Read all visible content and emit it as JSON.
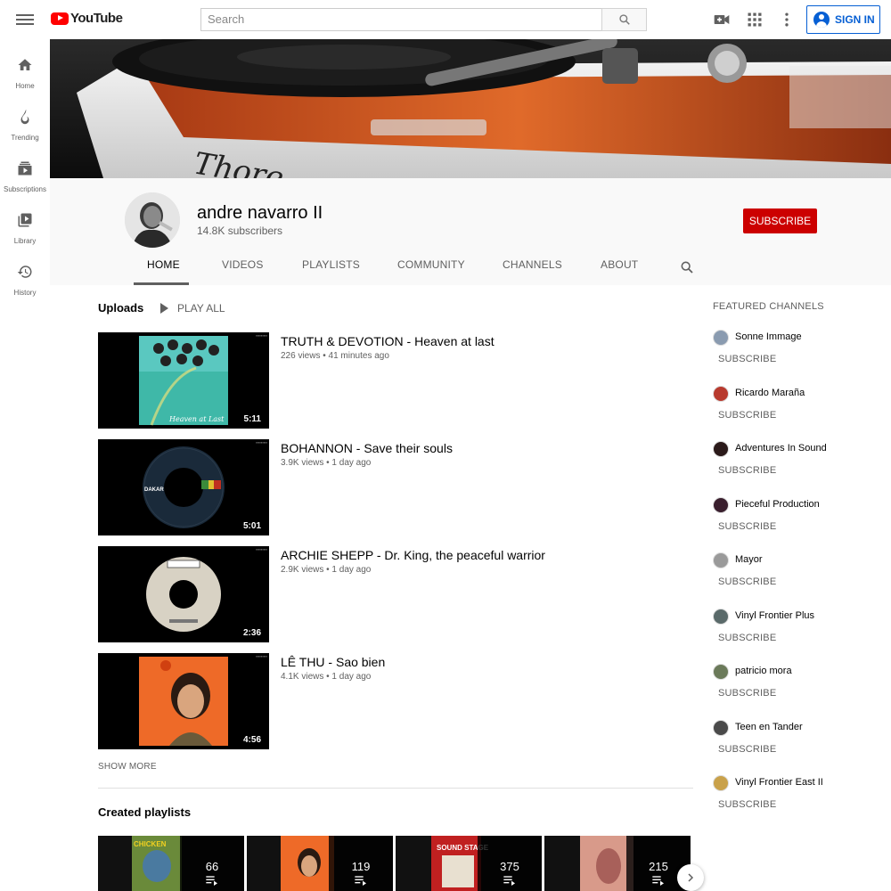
{
  "header": {
    "logo_text": "YouTube",
    "search_placeholder": "Search",
    "sign_in_label": "SIGN IN"
  },
  "sidebar": {
    "items": [
      {
        "label": "Home",
        "icon": "home-icon"
      },
      {
        "label": "Trending",
        "icon": "fire-icon"
      },
      {
        "label": "Subscriptions",
        "icon": "subscriptions-icon"
      },
      {
        "label": "Library",
        "icon": "library-icon"
      },
      {
        "label": "History",
        "icon": "history-icon"
      }
    ]
  },
  "channel": {
    "name": "andre navarro II",
    "subscribers": "14.8K subscribers",
    "subscribe_label": "SUBSCRIBE",
    "tabs": [
      "HOME",
      "VIDEOS",
      "PLAYLISTS",
      "COMMUNITY",
      "CHANNELS",
      "ABOUT"
    ],
    "active_tab": "HOME"
  },
  "uploads": {
    "title": "Uploads",
    "play_all_label": "PLAY ALL",
    "videos": [
      {
        "title": "TRUTH & DEVOTION - Heaven at last",
        "views": "226 views",
        "age": "41 minutes ago",
        "duration": "5:11"
      },
      {
        "title": "BOHANNON - Save their souls",
        "views": "3.9K views",
        "age": "1 day ago",
        "duration": "5:01"
      },
      {
        "title": "ARCHIE SHEPP - Dr. King, the peaceful warrior",
        "views": "2.9K views",
        "age": "1 day ago",
        "duration": "2:36"
      },
      {
        "title": "LÊ THU - Sao bien",
        "views": "4.1K views",
        "age": "1 day ago",
        "duration": "4:56"
      }
    ],
    "show_more_label": "SHOW MORE"
  },
  "created_playlists": {
    "title": "Created playlists",
    "counts": [
      "66",
      "119",
      "375",
      "215"
    ]
  },
  "featured": {
    "title": "FEATURED CHANNELS",
    "subscribe_label": "SUBSCRIBE",
    "channels": [
      {
        "name": "Sonne Immage",
        "color": "#8a9bb0"
      },
      {
        "name": "Ricardo Maraña",
        "color": "#b83a2e"
      },
      {
        "name": "Adventures In Sound",
        "color": "#2b1a1a"
      },
      {
        "name": "Pieceful Production",
        "color": "#3a1f2e"
      },
      {
        "name": "Mayor",
        "color": "#9a9a9a"
      },
      {
        "name": "Vinyl Frontier Plus",
        "color": "#5a6a6a"
      },
      {
        "name": "patricio mora",
        "color": "#6b7a5a"
      },
      {
        "name": "Teen en Tander",
        "color": "#4a4a4a"
      },
      {
        "name": "Vinyl Frontier East II",
        "color": "#c9a14a"
      }
    ]
  },
  "colors": {
    "brand_red": "#ff0000",
    "subscribe_red": "#cc0000",
    "link_blue": "#065fd4"
  }
}
